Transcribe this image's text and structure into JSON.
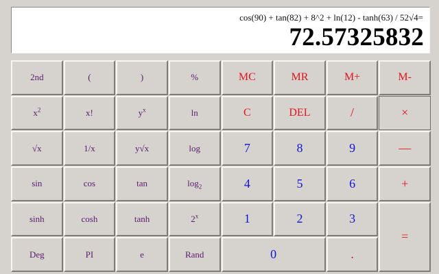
{
  "display": {
    "expression": "cos(90) + tan(82) + 8^2 + ln(12) - tanh(63) / 52√4=",
    "result": "72.57325832"
  },
  "keys": {
    "second": "2nd",
    "open_paren": "(",
    "close_paren": ")",
    "percent": "%",
    "mc": "MC",
    "mr": "MR",
    "m_plus": "M+",
    "m_minus": "M-",
    "x_squared_base": "x",
    "x_squared_exp": "2",
    "factorial": "x!",
    "y_pow_x_base": "y",
    "y_pow_x_exp": "x",
    "ln": "ln",
    "clear": "C",
    "delete": "DEL",
    "divide": "/",
    "multiply": "×",
    "sqrt": "√x",
    "reciprocal": "1/x",
    "y_root_x": "y√x",
    "log": "log",
    "seven": "7",
    "eight": "8",
    "nine": "9",
    "minus": "—",
    "sin": "sin",
    "cos": "cos",
    "tan": "tan",
    "log2_base": "log",
    "log2_sub": "2",
    "four": "4",
    "five": "5",
    "six": "6",
    "plus": "+",
    "sinh": "sinh",
    "cosh": "cosh",
    "tanh": "tanh",
    "two_pow_x_base": "2",
    "two_pow_x_exp": "x",
    "one": "1",
    "two": "2",
    "three": "3",
    "equals": "=",
    "deg": "Deg",
    "pi": "PI",
    "e": "e",
    "rand": "Rand",
    "zero": "0",
    "decimal": "."
  },
  "colors": {
    "background": "#d6d3cf",
    "function_text": "#5a1a6e",
    "memory_operator_text": "#e0141e",
    "digit_text": "#1414d2"
  }
}
